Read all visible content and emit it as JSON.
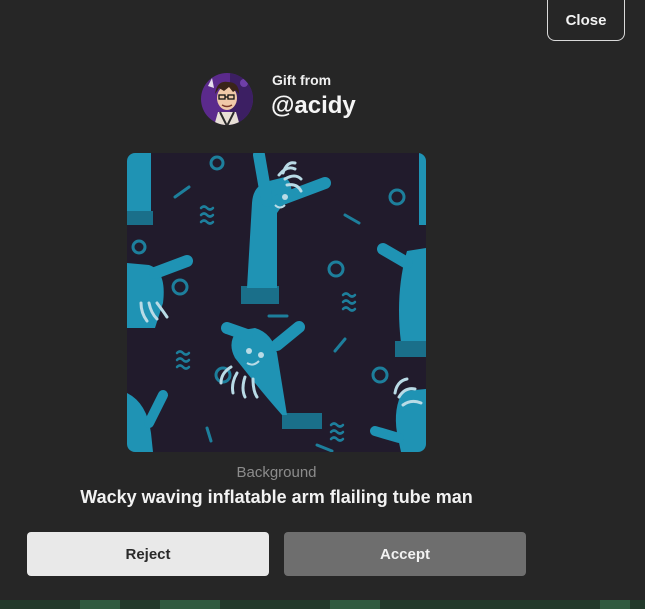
{
  "dialog": {
    "close_label": "Close",
    "gift_from_label": "Gift from",
    "sender_handle": "@acidy",
    "item_category": "Background",
    "item_name": "Wacky waving inflatable arm flailing tube man",
    "reject_label": "Reject",
    "accept_label": "Accept"
  },
  "icons": {
    "avatar": "sender-avatar",
    "preview": "tube-man-background-preview"
  },
  "colors": {
    "modal_bg": "#262626",
    "preview_bg": "#211b2c",
    "tube_man": "#1f93b4",
    "accept_bg": "#6e6e6e",
    "reject_bg": "#e9e9e9"
  }
}
